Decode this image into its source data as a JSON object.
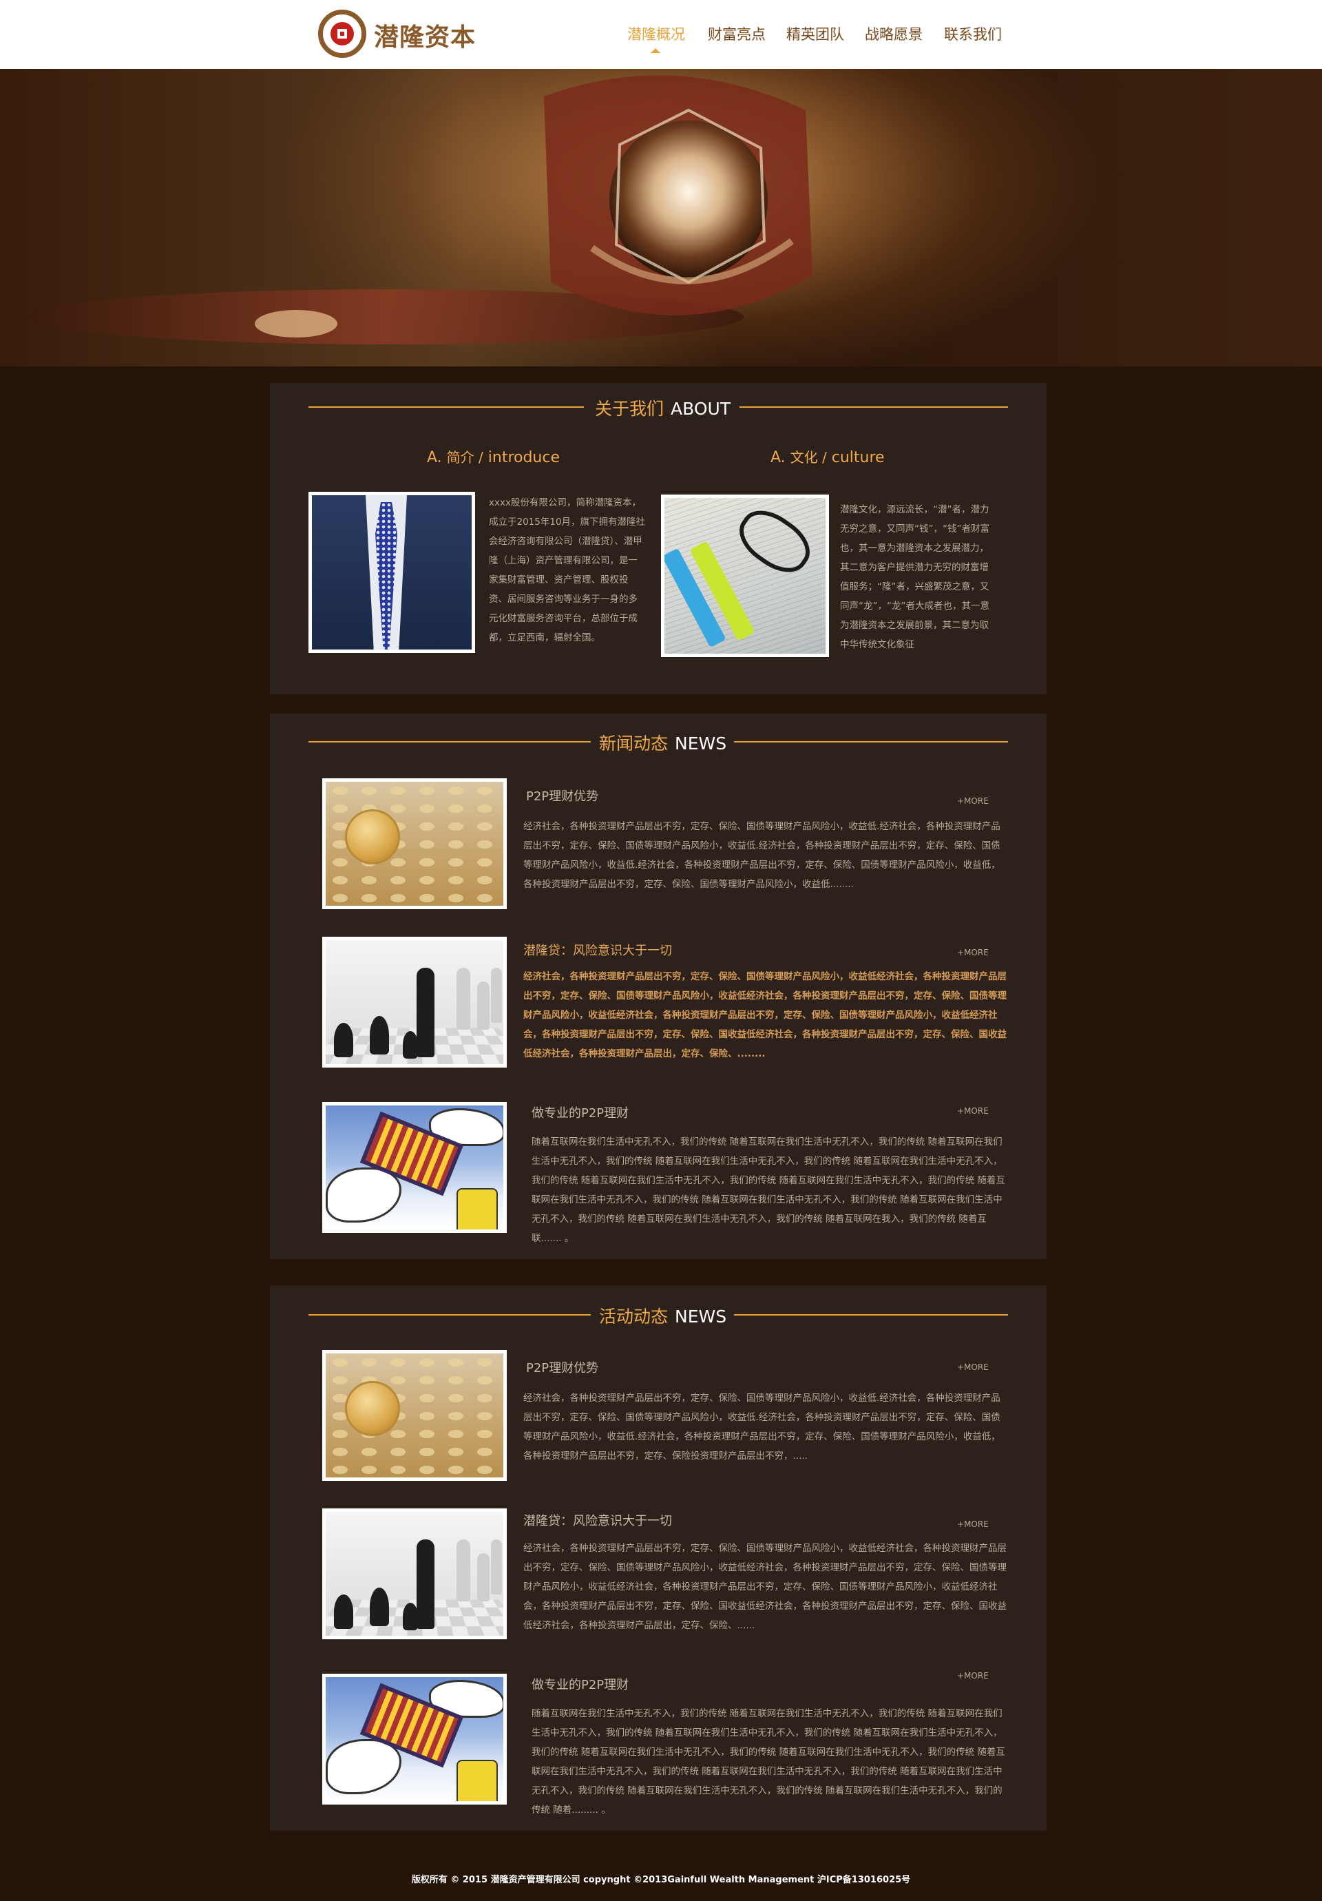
{
  "header": {
    "brand": "潜隆资本",
    "nav": [
      "潜隆概况",
      "财富亮点",
      "精英团队",
      "战略愿景",
      "联系我们"
    ],
    "active_index": 0
  },
  "about": {
    "title_cn": "关于我们",
    "title_en": "ABOUT",
    "intro": {
      "prefix": "A.",
      "cn": "简介 /",
      "en": "introduce",
      "text": "xxxx股份有限公司，简称潜隆资本，成立于2015年10月，旗下拥有潜隆社会经济咨询有限公司（潜隆贷）、潜甲隆（上海）资产管理有限公司，是一家集财富管理、资产管理、股权投资、居间服务咨询等业务于一身的多元化财富服务咨询平台，总部位于成都，立足西南，辐射全国。"
    },
    "culture": {
      "prefix": "A.",
      "cn": "文化 /",
      "en": "culture",
      "text": "潜隆文化，源远流长，“潜”者，潜力无穷之意，又同声“钱”，“钱”者财富也，其一意为潜隆资本之发展潜力，其二意为客户提供潜力无穷的财富增值服务；“隆”者，兴盛繁茂之意，又同声“龙”，“龙”者大成者也，其一意为潜隆资本之发展前景，其二意为取中华传统文化象征"
    }
  },
  "news": {
    "title_cn": "新闻动态",
    "title_en": "NEWS",
    "items": [
      {
        "title": "P2P理财优势",
        "more": "+MORE",
        "text": "经济社会，各种投资理财产品层出不穷，定存、保险、国债等理财产品风险小，收益低.经济社会，各种投资理财产品层出不穷，定存、保险、国债等理财产品风险小，收益低.经济社会，各种投资理财产品层出不穷，定存、保险、国债等理财产品风险小，收益低.经济社会，各种投资理财产品层出不穷，定存、保险、国债等理财产品风险小，收益低，各种投资理财产品层出不穷，定存、保险、国债等理财产品风险小，收益低........"
      },
      {
        "title": "潜隆贷：风险意识大于一切",
        "more": "+MORE",
        "text": "经济社会，各种投资理财产品层出不穷，定存、保险、国债等理财产品风险小，收益低经济社会，各种投资理财产品层出不穷，定存、保险、国债等理财产品风险小，收益低经济社会，各种投资理财产品层出不穷，定存、保险、国债等理财产品风险小，收益低经济社会，各种投资理财产品层出不穷，定存、保险、国债等理财产品风险小，收益低经济社会，各种投资理财产品层出不穷，定存、保险、国收益低经济社会，各种投资理财产品层出不穷，定存、保险、国收益低经济社会，各种投资理财产品层出，定存、保险、........"
      },
      {
        "title": "做专业的P2P理财",
        "more": "+MORE",
        "text": "随着互联网在我们生活中无孔不入，我们的传统 随着互联网在我们生活中无孔不入，我们的传统 随着互联网在我们生活中无孔不入，我们的传统 随着互联网在我们生活中无孔不入，我们的传统 随着互联网在我们生活中无孔不入，我们的传统 随着互联网在我们生活中无孔不入，我们的传统 随着互联网在我们生活中无孔不入，我们的传统 随着互联网在我们生活中无孔不入，我们的传统 随着互联网在我们生活中无孔不入，我们的传统 随着互联网在我们生活中无孔不入，我们的传统 随着互联网在我们生活中无孔不入，我们的传统 随着互联网在我入，我们的传统 随着互联.......  。"
      }
    ]
  },
  "events": {
    "title_cn": "活动动态",
    "title_en": "NEWS",
    "items": [
      {
        "title": "P2P理财优势",
        "more": "+MORE",
        "text": "经济社会，各种投资理财产品层出不穷，定存、保险、国债等理财产品风险小，收益低.经济社会，各种投资理财产品层出不穷，定存、保险、国债等理财产品风险小，收益低.经济社会，各种投资理财产品层出不穷，定存、保险、国债等理财产品风险小，收益低.经济社会，各种投资理财产品层出不穷，定存、保险、国债等理财产品风险小，收益低，各种投资理财产品层出不穷，定存、保险投资理财产品层出不穷，....."
      },
      {
        "title": "潜隆贷：风险意识大于一切",
        "more": "+MORE",
        "text": "经济社会，各种投资理财产品层出不穷，定存、保险、国债等理财产品风险小，收益低经济社会，各种投资理财产品层出不穷，定存、保险、国债等理财产品风险小，收益低经济社会，各种投资理财产品层出不穷，定存、保险、国债等理财产品风险小，收益低经济社会，各种投资理财产品层出不穷，定存、保险、国债等理财产品风险小，收益低经济社会，各种投资理财产品层出不穷，定存、保险、国收益低经济社会，各种投资理财产品层出不穷，定存、保险、国收益低经济社会，各种投资理财产品层出，定存、保险、......"
      },
      {
        "title": "做专业的P2P理财",
        "more": "+MORE",
        "text": "随着互联网在我们生活中无孔不入，我们的传统 随着互联网在我们生活中无孔不入，我们的传统 随着互联网在我们生活中无孔不入，我们的传统 随着互联网在我们生活中无孔不入，我们的传统 随着互联网在我们生活中无孔不入，我们的传统 随着互联网在我们生活中无孔不入，我们的传统 随着互联网在我们生活中无孔不入，我们的传统 随着互联网在我们生活中无孔不入，我们的传统 随着互联网在我们生活中无孔不入，我们的传统 随着互联网在我们生活中无孔不入，我们的传统 随着互联网在我们生活中无孔不入，我们的传统 随着互联网在我们生活中无孔不入，我们的传统 随着.........  。"
      }
    ]
  },
  "footer": {
    "text": "版权所有 © 2015 潜隆资产管理有限公司  copynght ©2013Gainfull Wealth Management    沪ICP备13016025号"
  },
  "colors": {
    "accent": "#e8a43a",
    "background": "#241409",
    "panel": "#2d211c"
  },
  "icons": {
    "logo": "coin-logo-icon",
    "nav_indicator": "caret-up-icon"
  }
}
